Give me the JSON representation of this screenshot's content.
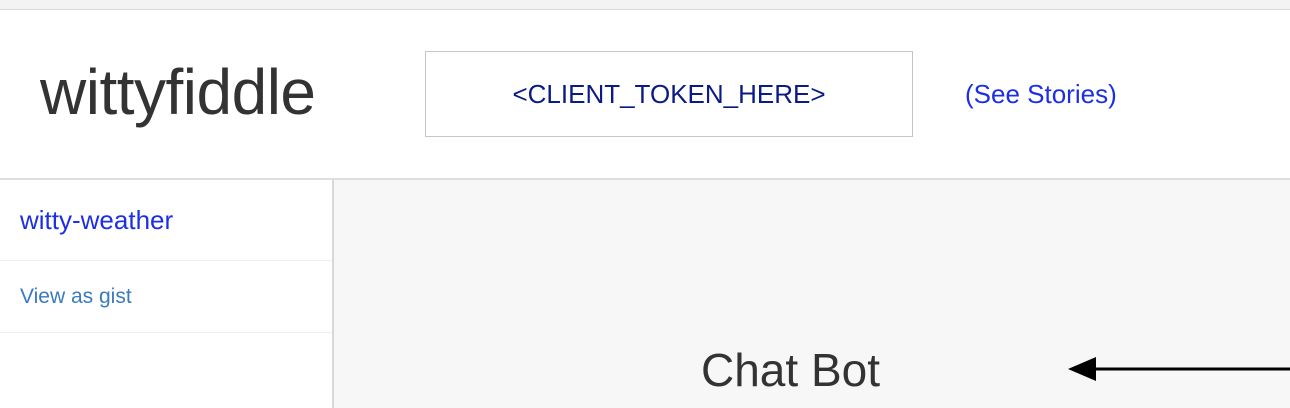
{
  "header": {
    "app_name": "wittyfiddle",
    "token_field": {
      "value": "<CLIENT_TOKEN_HERE>"
    },
    "see_stories_label": "(See Stories)"
  },
  "sidebar": {
    "title": "witty-weather",
    "view_as_gist_label": "View as gist"
  },
  "main": {
    "title": "Chat Bot"
  },
  "colors": {
    "link": "#1d2fe3",
    "token_text": "#0b1b86",
    "sidebar_link": "#3a7bbf",
    "main_background": "#f7f7f7",
    "text_dark": "#333333"
  },
  "icons": {
    "annotation": "left-arrow-icon"
  }
}
